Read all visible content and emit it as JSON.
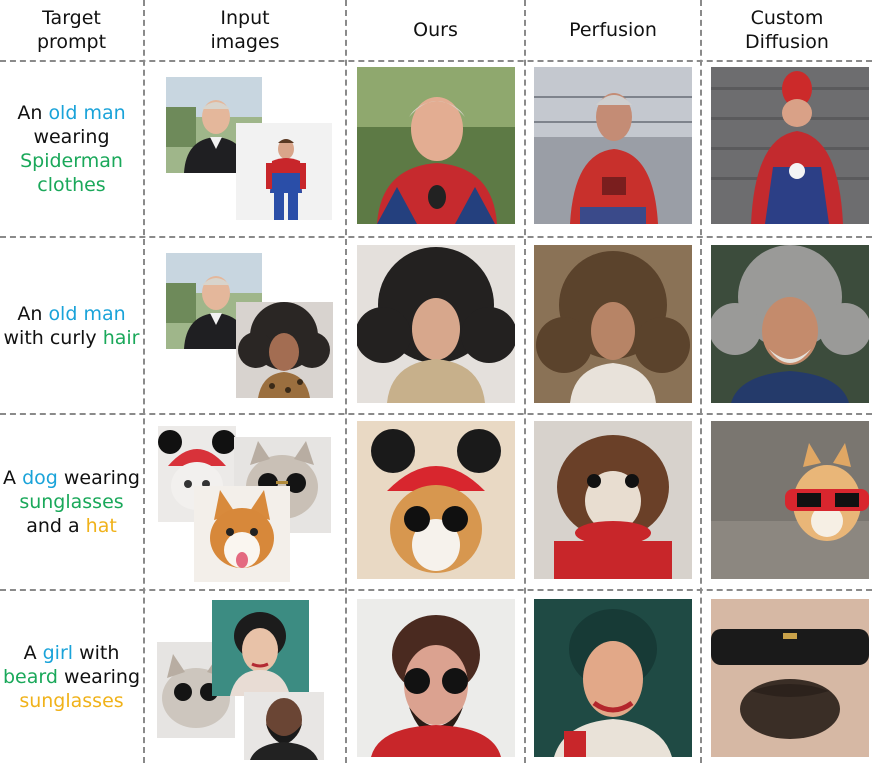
{
  "headers": [
    "Target\nprompt",
    "Input\nimages",
    "Ours",
    "Perfusion",
    "Custom\nDiffusion"
  ],
  "rows": [
    {
      "prompt": [
        {
          "text": "An ",
          "c": "plain"
        },
        {
          "text": "old man",
          "c": "subj"
        },
        {
          "text": " wearing ",
          "c": "plain"
        },
        {
          "text": "Spiderman clothes",
          "c": "attr"
        }
      ]
    },
    {
      "prompt": [
        {
          "text": "An ",
          "c": "plain"
        },
        {
          "text": "old man",
          "c": "subj"
        },
        {
          "text": " with curly ",
          "c": "plain"
        },
        {
          "text": "hair",
          "c": "attr"
        }
      ]
    },
    {
      "prompt": [
        {
          "text": "A ",
          "c": "plain"
        },
        {
          "text": "dog",
          "c": "subj"
        },
        {
          "text": " wearing ",
          "c": "plain"
        },
        {
          "text": "sunglasses",
          "c": "attr"
        },
        {
          "text": " and a ",
          "c": "plain"
        },
        {
          "text": "hat",
          "c": "extra"
        }
      ]
    },
    {
      "prompt": [
        {
          "text": "A ",
          "c": "plain"
        },
        {
          "text": "girl",
          "c": "subj"
        },
        {
          "text": " with ",
          "c": "plain"
        },
        {
          "text": "beard",
          "c": "attr"
        },
        {
          "text": " wearing ",
          "c": "plain"
        },
        {
          "text": "sunglasses",
          "c": "extra"
        }
      ]
    }
  ],
  "colors": {
    "subject": "#1aa3d9",
    "attribute": "#1aa85a",
    "extra": "#f0b21a",
    "divider": "#8a8a8a"
  }
}
